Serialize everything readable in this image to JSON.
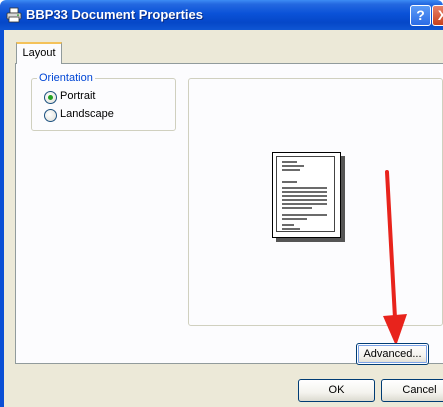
{
  "window": {
    "title": "BBP33 Document Properties",
    "help_glyph": "?",
    "close_glyph": "X",
    "title_icon": "printer-icon"
  },
  "tabs": [
    {
      "label": "Layout",
      "selected": true
    }
  ],
  "orientation": {
    "group_label": "Orientation",
    "options": [
      {
        "label": "Portrait",
        "selected": true
      },
      {
        "label": "Landscape",
        "selected": false
      }
    ]
  },
  "buttons": {
    "advanced": "Advanced...",
    "ok": "OK",
    "cancel": "Cancel"
  },
  "annotation": {
    "arrow_color": "#e8231c"
  },
  "colors": {
    "titlebar": "#0a52d8",
    "dialog_bg": "#ece9d8",
    "group_label": "#0046d5",
    "radio_dot": "#21a121"
  }
}
